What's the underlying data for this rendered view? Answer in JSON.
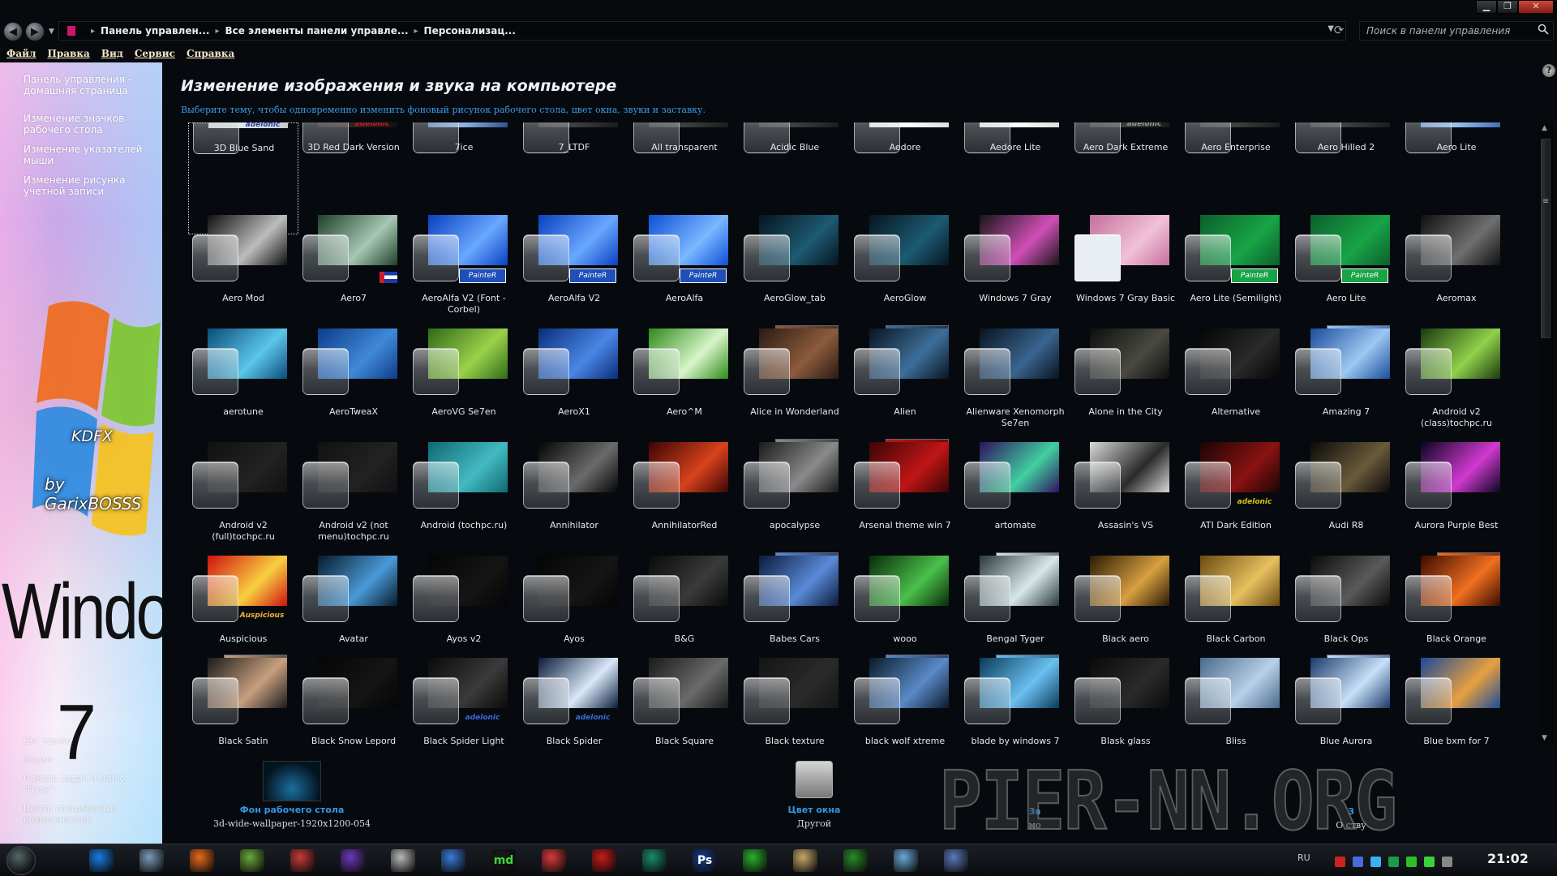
{
  "window": {
    "controls": [
      "minimize",
      "maximize",
      "close"
    ]
  },
  "breadcrumbs": [
    "Панель управлен...",
    "Все элементы панели управле...",
    "Персонализац..."
  ],
  "search": {
    "placeholder": "Поиск в панели управления"
  },
  "menu": [
    "Файл",
    "Правка",
    "Вид",
    "Сервис",
    "Справка"
  ],
  "sidebar": {
    "links": [
      "Панель управления - домашняя страница",
      "Изменение значков рабочего стола",
      "Изменение указателей мыши",
      "Изменение рисунка учетной записи"
    ],
    "see_also": [
      "См. также",
      "Экран",
      "Панель задач и меню \"Пуск\"",
      "Центр специальных возможностей"
    ],
    "kdfx": "KDFX",
    "garix": "by GarixBOSSS",
    "windows_word": "Windows",
    "seven": "7"
  },
  "main": {
    "title": "Изменение изображения и звука на компьютере",
    "description": "Выберите тему, чтобы одновременно изменить фоновый рисунок рабочего стола, цвет окна, звуки и заставку."
  },
  "themes": [
    {
      "name": "3D Blue Sand",
      "c1": "#c9c9c9",
      "c2": "#dfe6ea",
      "badge": "adelonic",
      "badge_color": "#2c3ea8",
      "selected": true
    },
    {
      "name": "3D Red Dark Version",
      "c1": "#111111",
      "c2": "#332222",
      "badge": "adelonic",
      "badge_color": "#d01818"
    },
    {
      "name": "7ice",
      "c1": "#2a4d82",
      "c2": "#8fb6e8"
    },
    {
      "name": "7_LTDF",
      "c1": "#1a1a1a",
      "c2": "#404040"
    },
    {
      "name": "All transparent",
      "c1": "#1a1a1a",
      "c2": "#404040"
    },
    {
      "name": "Acidic Blue",
      "c1": "#1a1a1a",
      "c2": "#404040"
    },
    {
      "name": "Aedore",
      "c1": "#dcdcdc",
      "c2": "#ffffff"
    },
    {
      "name": "Aedore Lite",
      "c1": "#dcdcdc",
      "c2": "#ffffff"
    },
    {
      "name": "Aero Dark Extreme",
      "c1": "#1a1a1a",
      "c2": "#3d3d3d",
      "badge": "adelonic",
      "badge_color": "#999999"
    },
    {
      "name": "Aero Enterprise",
      "c1": "#1a1a1a",
      "c2": "#404040"
    },
    {
      "name": "Aero Hilled 2",
      "c1": "#1a1a1a",
      "c2": "#404040"
    },
    {
      "name": "Aero Lite",
      "c1": "#3d6ab6",
      "c2": "#9cc2ee"
    },
    {
      "name": "Aero Mod",
      "c1": "#0f0f0f",
      "c2": "#bdbdbd"
    },
    {
      "name": "Aero7",
      "c1": "#1f3f2a",
      "c2": "#a6c7b3",
      "badge": "flag",
      "badge_color": "#cc1f2d"
    },
    {
      "name": "AeroAlfa V2 (Font - Corbel)",
      "c1": "#0a3fc0",
      "c2": "#69a8ff",
      "badge": "PainteR",
      "badge_color": "#1f4fb8"
    },
    {
      "name": "AeroAlfa V2",
      "c1": "#0a3fc0",
      "c2": "#69a8ff",
      "badge": "PainteR",
      "badge_color": "#1f4fb8"
    },
    {
      "name": "AeroAlfa",
      "c1": "#0d4fd6",
      "c2": "#7ab8ff",
      "badge": "PainteR",
      "badge_color": "#1f4fb8"
    },
    {
      "name": "AeroGlow_tab",
      "c1": "#06151f",
      "c2": "#1d5a72"
    },
    {
      "name": "AeroGlow",
      "c1": "#06151f",
      "c2": "#1d5a72"
    },
    {
      "name": "Windows 7 Gray",
      "c1": "#161616",
      "c2": "#d14fb8"
    },
    {
      "name": "Windows 7 Gray Basic",
      "c1": "#c36f9b",
      "c2": "#f2c2d7",
      "badge": "basic"
    },
    {
      "name": "Aero Lite (Semilight)",
      "c1": "#0e5e2c",
      "c2": "#17a446",
      "badge": "PainteR",
      "badge_color": "#17a446"
    },
    {
      "name": "Aero Lite",
      "c1": "#0e5e2c",
      "c2": "#17a446",
      "badge": "PainteR",
      "badge_color": "#17a446"
    },
    {
      "name": "Aeromax",
      "c1": "#0f0f0f",
      "c2": "#6f6f6f"
    },
    {
      "name": "aerotune",
      "c1": "#0a4c7a",
      "c2": "#5bc6e8"
    },
    {
      "name": "AeroTweaX",
      "c1": "#0d3c8a",
      "c2": "#3f89d8"
    },
    {
      "name": "AeroVG Se7en",
      "c1": "#2e6a18",
      "c2": "#9bd14a"
    },
    {
      "name": "AeroX1",
      "c1": "#0b2d7a",
      "c2": "#4a86e6"
    },
    {
      "name": "Aero^M",
      "c1": "#2d8a19",
      "c2": "#d8f5c9"
    },
    {
      "name": "Alice in Wonderland",
      "c1": "#2a1a14",
      "c2": "#8c5b3c",
      "stack": true
    },
    {
      "name": "Alien",
      "c1": "#0a1420",
      "c2": "#3d6f9a",
      "stack": true
    },
    {
      "name": "Alienware Xenomorph Se7en",
      "c1": "#081320",
      "c2": "#39658f"
    },
    {
      "name": "Alone in the City",
      "c1": "#0d0d0d",
      "c2": "#4a4a42"
    },
    {
      "name": "Alternative",
      "c1": "#050505",
      "c2": "#2a2a2a"
    },
    {
      "name": "Amazing 7",
      "c1": "#1a4c9a",
      "c2": "#9cc8f2",
      "stack": true
    },
    {
      "name": "Android v2 (class)tochpc.ru",
      "c1": "#1b3a0f",
      "c2": "#8fd14a"
    },
    {
      "name": "Android v2 (full)tochpc.ru",
      "c1": "#111111",
      "c2": "#222222"
    },
    {
      "name": "Android v2 (not menu)tochpc.ru",
      "c1": "#111111",
      "c2": "#222222"
    },
    {
      "name": "Android (tochpc.ru)",
      "c1": "#0e6a73",
      "c2": "#43b9c1"
    },
    {
      "name": "Annihilator",
      "c1": "#050505",
      "c2": "#6b6b6b"
    },
    {
      "name": "AnnihilatorRed",
      "c1": "#3a0505",
      "c2": "#d8421b"
    },
    {
      "name": "apocalypse",
      "c1": "#1a1a1a",
      "c2": "#8a8a8a",
      "stack": true
    },
    {
      "name": "Arsenal theme win 7",
      "c1": "#3a0505",
      "c2": "#c01616",
      "stack": true
    },
    {
      "name": "artomate",
      "c1": "#301060",
      "c2": "#40d0a0"
    },
    {
      "name": "Assasin's VS",
      "c1": "#d8d8d8",
      "c2": "#2a2a2a"
    },
    {
      "name": "ATI Dark Edition",
      "c1": "#1a0505",
      "c2": "#8a1212",
      "badge": "adelonic",
      "badge_color": "#d9c21b"
    },
    {
      "name": "Audi R8",
      "c1": "#0a0a0a",
      "c2": "#6a5a3a"
    },
    {
      "name": "Aurora Purple Best",
      "c1": "#0a0520",
      "c2": "#d03ad0"
    },
    {
      "name": "Auspicious",
      "c1": "#d01010",
      "c2": "#f8d040",
      "badge": "Auspicious",
      "badge_color": "#f2b43a"
    },
    {
      "name": "Avatar",
      "c1": "#061a2a",
      "c2": "#4a9ad8"
    },
    {
      "name": "Ayos v2",
      "c1": "#050505",
      "c2": "#151515"
    },
    {
      "name": "Ayos",
      "c1": "#050505",
      "c2": "#151515"
    },
    {
      "name": "B&G",
      "c1": "#0a0a0a",
      "c2": "#3a3a3a"
    },
    {
      "name": "Babes Cars",
      "c1": "#0a1a3a",
      "c2": "#5a8ad8",
      "stack": true
    },
    {
      "name": "wooo",
      "c1": "#0a2a0a",
      "c2": "#4ac04a"
    },
    {
      "name": "Bengal Tyger",
      "c1": "#2a3a3a",
      "c2": "#d8e8e8",
      "stack": true
    },
    {
      "name": "Black aero",
      "c1": "#2a1a05",
      "c2": "#d8a040"
    },
    {
      "name": "Black Carbon",
      "c1": "#6a4a10",
      "c2": "#e8c060"
    },
    {
      "name": "Black Ops",
      "c1": "#0a0a0a",
      "c2": "#5a5a5a"
    },
    {
      "name": "Black Orange",
      "c1": "#3a0a00",
      "c2": "#f07020",
      "stack": true
    },
    {
      "name": "Black Satin",
      "c1": "#1a1a1a",
      "c2": "#c8a080",
      "stack": true
    },
    {
      "name": "Black Snow Lepord",
      "c1": "#050505",
      "c2": "#151515"
    },
    {
      "name": "Black Spider Light",
      "c1": "#0a0a0a",
      "c2": "#3a3a3a",
      "badge": "adelonic",
      "badge_color": "#3a6ad8"
    },
    {
      "name": "Black Spider",
      "c1": "#0a1a3a",
      "c2": "#d8e8f8",
      "badge": "adelonic",
      "badge_color": "#3a6ad8"
    },
    {
      "name": "Black Square",
      "c1": "#1a1a1a",
      "c2": "#6a6a6a"
    },
    {
      "name": "Black texture",
      "c1": "#151515",
      "c2": "#2a2a2a"
    },
    {
      "name": "black wolf xtreme",
      "c1": "#0a1a2a",
      "c2": "#5a8ac8",
      "stack": true
    },
    {
      "name": "blade by windows 7",
      "c1": "#0a3a5a",
      "c2": "#6ac0f0",
      "stack": true
    },
    {
      "name": "Blask glass",
      "c1": "#0a0a0a",
      "c2": "#2a2a2a"
    },
    {
      "name": "Bliss",
      "c1": "#4a6a8a",
      "c2": "#b8d0e8"
    },
    {
      "name": "Blue Aurora",
      "c1": "#1a3a6a",
      "c2": "#c8e0f8",
      "stack": true
    },
    {
      "name": "Blue bxm  for 7",
      "c1": "#1a4a9a",
      "c2": "#e8a040"
    },
    {
      "name": "",
      "c1": "#0a3a8a",
      "c2": "#5aa8f0"
    },
    {
      "name": "",
      "c1": "#1a3a6a",
      "c2": "#a8c8e8",
      "stack": true
    },
    {
      "name": "",
      "c1": "#0a1a3a",
      "c2": "#3a6aa8",
      "stack": true
    },
    {
      "name": "",
      "c1": "#0a1a3a",
      "c2": "#3a6aa8"
    },
    {
      "name": "",
      "c1": "#a83a1a",
      "c2": "#f0a060"
    },
    {
      "name": "",
      "c1": "#1a4a8a",
      "c2": "#6ab0e8"
    },
    {
      "name": "",
      "c1": "#1a2a4a",
      "c2": "#d8c890",
      "stack": true
    },
    {
      "name": "",
      "c1": "#3a0a8a",
      "c2": "#d84ad8"
    },
    {
      "name": "",
      "c1": "#8a4a6a",
      "c2": "#e8d8d8",
      "stack": true
    },
    {
      "name": "",
      "c1": "#8a0a0a",
      "c2": "#e04040"
    },
    {
      "name": "",
      "c1": "#c86a6a",
      "c2": "#f8e0d8"
    },
    {
      "name": "",
      "c1": "#2a2a2a",
      "c2": "#8a8a8a"
    }
  ],
  "bottom": {
    "wallpaper_link": "Фон рабочего стола",
    "wallpaper_value": "3d-wide-wallpaper-1920x1200-054",
    "color_link": "Цвет окна",
    "color_value": "Другой",
    "sounds_link": "Зв",
    "sounds_value": "мо",
    "screensaver_link": "З",
    "screensaver_value": "О   ству",
    "watermark": "PIER-NN.ORG"
  },
  "taskbar": {
    "apps": [
      "ie-icon",
      "notepad-icon",
      "media-player-icon",
      "notepad-plus-icon",
      "pen-icon",
      "visual-studio-icon",
      "scissors-icon",
      "c-icon",
      "md-icon",
      "paint-icon",
      "opera-icon",
      "green-globe-icon",
      "photoshop-icon",
      "drive-icon",
      "file-icon",
      "utorrent-icon",
      "palette-icon",
      "remote-icon"
    ],
    "ps_label": "Ps",
    "md_label": "md",
    "lang": "RU",
    "clock": "21:02"
  },
  "colors": {
    "link": "#3596e4",
    "accent": "#d0166a"
  }
}
